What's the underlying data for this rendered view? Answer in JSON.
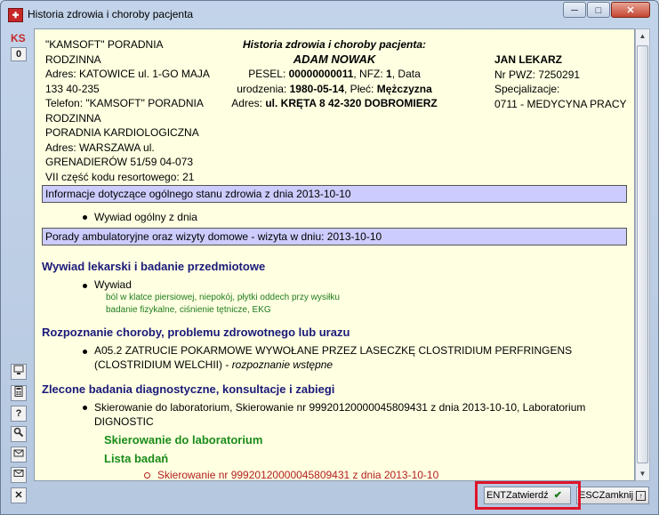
{
  "window": {
    "title": "Historia zdrowia i choroby pacjenta",
    "controls": [
      "─",
      "□",
      "✕"
    ]
  },
  "toolbar": {
    "top_icon": "KS",
    "counter": "0",
    "icons": [
      "monitor-icon",
      "calculator-icon",
      "help-icon",
      "search-icon",
      "mail-open-icon",
      "mail-icon",
      "close-icon"
    ],
    "help_label": "?",
    "close_label": "✕"
  },
  "clinic": {
    "lines": [
      "\"KAMSOFT\" PORADNIA",
      "RODZINNA",
      "Adres: KATOWICE ul. 1-GO MAJA",
      "133 40-235",
      "Telefon: \"KAMSOFT\" PORADNIA",
      "RODZINNA",
      "PORADNIA KARDIOLOGICZNA",
      "Adres: WARSZAWA ul.",
      "GRENADIERÓW 51/59 04-073",
      "VII część kodu resortowego: 21"
    ]
  },
  "patient": {
    "heading": "Historia zdrowia i choroby pacjenta:",
    "name": "ADAM NOWAK",
    "pesel_label": "PESEL:",
    "pesel": "00000000011",
    "nfz_label": ", NFZ:",
    "nfz": "1",
    "dob_label_a": ", Data",
    "dob_label_b": "urodzenia:",
    "dob": "1980-05-14",
    "sex_label": ", Płeć:",
    "sex": "Mężczyzna",
    "addr_label": "Adres:",
    "addr": "ul. KRĘTA 8 42-320 DOBROMIERZ"
  },
  "doctor": {
    "name": "JAN LEKARZ",
    "pwz": "Nr PWZ: 7250291",
    "spec_label": "Specjalizacje:",
    "spec": "0711 - MEDYCYNA PRACY"
  },
  "general_box": "Informacje dotyczące ogólnego stanu zdrowia z dnia 2013-10-10",
  "general_item": "Wywiad ogólny z dnia",
  "visit_box": "Porady ambulatoryjne oraz wizyty domowe - wizyta w dniu: 2013-10-10",
  "sections": {
    "interview": {
      "title": "Wywiad lekarski i badanie przedmiotowe",
      "item": "Wywiad",
      "note1": "ból w klatce piersiowej, niepokój, płytki oddech przy wysiłku",
      "note2": "badanie fizykalne, ciśnienie tętnicze, EKG"
    },
    "diagnosis": {
      "title": "Rozpoznanie choroby, problemu zdrowotnego lub urazu",
      "line1": "A05.2 ZATRUCIE POKARMOWE WYWOŁANE PRZEZ LASECZKĘ CLOSTRIDIUM PERFRINGENS",
      "line2": "(CLOSTRIDIUM WELCHII) -",
      "qualifier": "rozpoznanie wstępne"
    },
    "orders": {
      "title": "Zlecone badania diagnostyczne, konsultacje i zabiegi",
      "line1": "Skierowanie do laboratorium, Skierowanie nr 99920120000045809431 z dnia 2013-10-10, Laboratorium",
      "line2": "DIGNOSTIC",
      "sub_title": "Skierowanie do laboratorium",
      "list_title": "Lista badań",
      "list_item": "Skierowanie nr 99920120000045809431 z dnia 2013-10-10"
    }
  },
  "footer": {
    "confirm_key": "ENT",
    "confirm_label": "Zatwierdź",
    "confirm_mark": "✔",
    "close_key": "ESC",
    "close_label": "Zamknij"
  }
}
